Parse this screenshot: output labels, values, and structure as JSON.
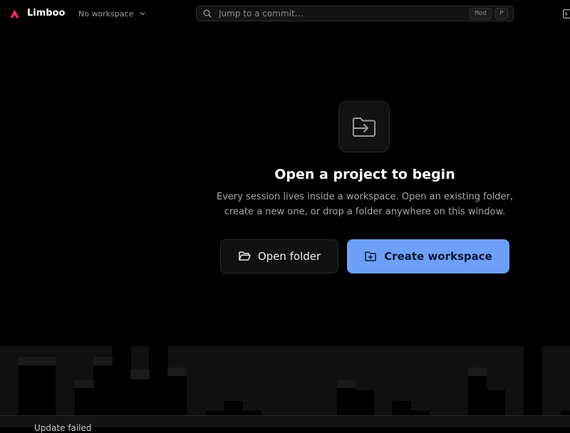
{
  "app": {
    "name": "Limboo",
    "accent_color": "#ff2d55"
  },
  "header": {
    "workspace_selector": "No workspace",
    "search": {
      "placeholder": "Jump to a commit…",
      "shortcut_keys": [
        "Mod",
        "P"
      ]
    },
    "icons": [
      "logo-icon",
      "chevron-down-icon",
      "search-icon",
      "terminal-icon"
    ]
  },
  "empty_state": {
    "icon": "folder-open-arrow-icon",
    "title": "Open a project to begin",
    "description_line1": "Every session lives inside a workspace. Open an existing folder,",
    "description_line2": "create a new one, or drop a folder anywhere on this window.",
    "open_folder_label": "Open folder",
    "create_workspace_label": "Create workspace",
    "primary_color": "#6ea0f8"
  },
  "status_bar": {
    "message": "Update failed"
  }
}
